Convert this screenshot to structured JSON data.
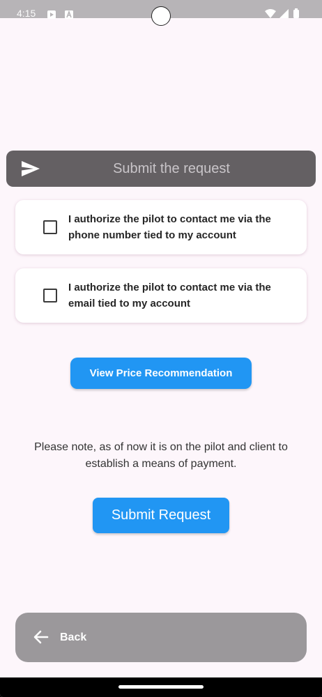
{
  "status_bar": {
    "time": "4:15",
    "icons": [
      "play-store-icon",
      "a-notification-icon",
      "wifi-icon",
      "signal-icon",
      "battery-icon"
    ]
  },
  "send_header": {
    "icon": "send-icon",
    "title": "Submit the request"
  },
  "consents": [
    {
      "label": "I authorize the pilot to contact me via the phone number tied to my account",
      "checked": false
    },
    {
      "label": "I authorize the pilot to contact me via the email tied to my account",
      "checked": false
    }
  ],
  "price_button": {
    "label": "View Price Recommendation"
  },
  "note": "Please note, as of now it is on the pilot and client to establish a means of payment.",
  "submit_button": {
    "label": "Submit Request"
  },
  "back_bar": {
    "icon": "arrow-back-icon",
    "label": "Back"
  },
  "colors": {
    "primary": "#2196f3",
    "background": "#fdf6fb",
    "header": "#646063",
    "back_bar": "#9b989b"
  }
}
